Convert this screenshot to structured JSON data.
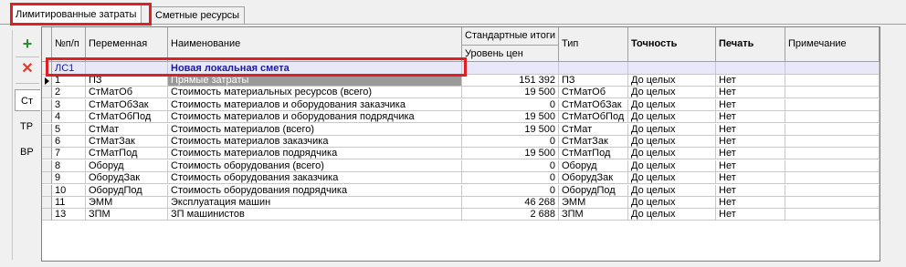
{
  "tabs": [
    {
      "label": "Лимитированные затраты",
      "active": true
    },
    {
      "label": "Сметные ресурсы",
      "active": false
    }
  ],
  "toolbar": {
    "add_icon": "plus-icon",
    "delete_icon": "cross-icon",
    "side_tabs": [
      "Ст",
      "ТР",
      "ВР"
    ]
  },
  "columns": {
    "num": "№п/п",
    "var": "Переменная",
    "name": "Наименование",
    "std_group": "Стандартные итоги",
    "price_level": "Уровень цен",
    "type": "Тип",
    "precision": "Точность",
    "print": "Печать",
    "note": "Примечание"
  },
  "group": {
    "num": "ЛС1",
    "name": "Новая локальная смета"
  },
  "rows": [
    {
      "num": "1",
      "var": "ПЗ",
      "name": "Прямые затраты",
      "value": "151 392",
      "type": "ПЗ",
      "precision": "До целых",
      "print": "Нет"
    },
    {
      "num": "2",
      "var": "СтМатОб",
      "name": "Стоимость материальных ресурсов (всего)",
      "value": "19 500",
      "type": "СтМатОб",
      "precision": "До целых",
      "print": "Нет"
    },
    {
      "num": "3",
      "var": "СтМатОбЗак",
      "name": "Стоимость материалов и оборудования заказчика",
      "value": "0",
      "type": "СтМатОбЗак",
      "precision": "До целых",
      "print": "Нет"
    },
    {
      "num": "4",
      "var": "СтМатОбПод",
      "name": "Стоимость материалов и оборудования подрядчика",
      "value": "19 500",
      "type": "СтМатОбПод",
      "precision": "До целых",
      "print": "Нет"
    },
    {
      "num": "5",
      "var": "СтМат",
      "name": "Стоимость материалов (всего)",
      "value": "19 500",
      "type": "СтМат",
      "precision": "До целых",
      "print": "Нет"
    },
    {
      "num": "6",
      "var": "СтМатЗак",
      "name": "Стоимость материалов заказчика",
      "value": "0",
      "type": "СтМатЗак",
      "precision": "До целых",
      "print": "Нет"
    },
    {
      "num": "7",
      "var": "СтМатПод",
      "name": "Стоимость материалов подрядчика",
      "value": "19 500",
      "type": "СтМатПод",
      "precision": "До целых",
      "print": "Нет"
    },
    {
      "num": "8",
      "var": "Оборуд",
      "name": "Стоимость оборудования (всего)",
      "value": "0",
      "type": "Оборуд",
      "precision": "До целых",
      "print": "Нет"
    },
    {
      "num": "9",
      "var": "ОборудЗак",
      "name": "Стоимость оборудования заказчика",
      "value": "0",
      "type": "ОборудЗак",
      "precision": "До целых",
      "print": "Нет"
    },
    {
      "num": "10",
      "var": "ОборудПод",
      "name": "Стоимость оборудования подрядчика",
      "value": "0",
      "type": "ОборудПод",
      "precision": "До целых",
      "print": "Нет"
    },
    {
      "num": "11",
      "var": "ЭММ",
      "name": "Эксплуатация машин",
      "value": "46 268",
      "type": "ЭММ",
      "precision": "До целых",
      "print": "Нет"
    },
    {
      "num": "13",
      "var": "ЗПМ",
      "name": "ЗП машинистов",
      "value": "2 688",
      "type": "ЗПМ",
      "precision": "До целых",
      "print": "Нет"
    }
  ],
  "colors": {
    "highlight": "#e02020",
    "group_text": "#1a1aa0",
    "selection": "#9a9a9a"
  }
}
